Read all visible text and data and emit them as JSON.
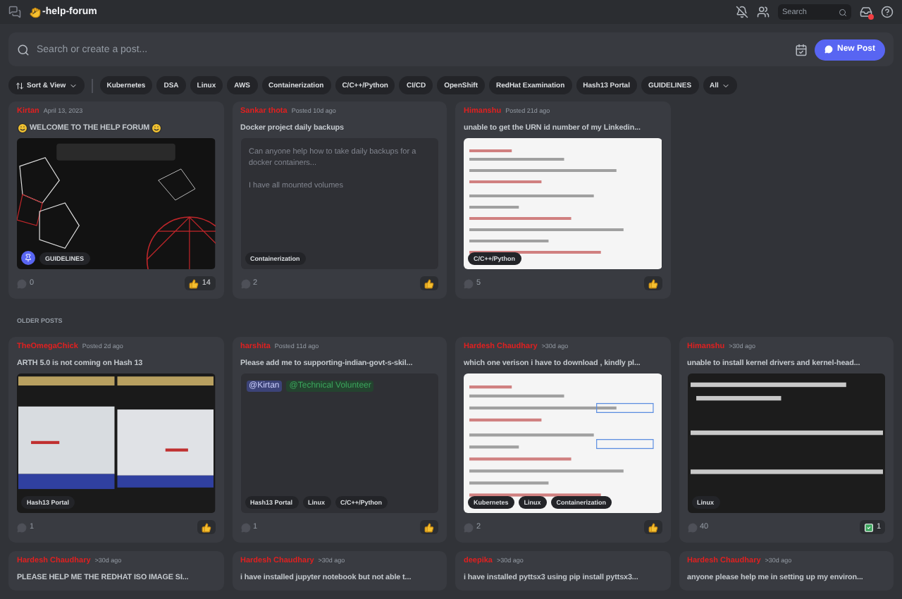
{
  "channel": {
    "name": "-help-forum",
    "search_placeholder": "Search"
  },
  "composer": {
    "placeholder": "Search or create a post...",
    "button": "New Post"
  },
  "filters": {
    "sort": "Sort & View",
    "tags": [
      {
        "label": "Kubernetes",
        "selected": false
      },
      {
        "label": "DSA",
        "selected": false
      },
      {
        "label": "Linux",
        "selected": false
      },
      {
        "label": "AWS",
        "selected": false
      },
      {
        "label": "Containerization",
        "selected": false
      },
      {
        "label": "C/C++/Python",
        "selected": false
      },
      {
        "label": "CI/CD",
        "selected": false
      },
      {
        "label": "OpenShift",
        "selected": false
      },
      {
        "label": "RedHat Examination",
        "selected": false
      },
      {
        "label": "Hash13 Portal",
        "selected": false
      },
      {
        "label": "GUIDELINES",
        "selected": false
      }
    ],
    "all": "All"
  },
  "pinned_posts": [
    {
      "author": "Kirtan",
      "time": "April 13, 2023",
      "title": "WELCOME TO THE HELP FORUM",
      "title_emoji": true,
      "media": {
        "kind": "picture"
      },
      "pinned": true,
      "tags": [
        "GUIDELINES"
      ],
      "comments": "0",
      "reaction": {
        "kind": "thumbs-up",
        "count": "14"
      }
    },
    {
      "author": "Sankar thota",
      "time": "Posted 10d ago",
      "title": "Docker project daily backups",
      "media": {
        "kind": "text",
        "paragraphs": [
          "Can anyone help how to take daily backups for a docker containers...",
          "I have all mounted volumes"
        ]
      },
      "tags": [
        "Containerization"
      ],
      "comments": "2",
      "reaction": {
        "kind": "thumbs-up"
      }
    },
    {
      "author": "Himanshu",
      "time": "Posted 21d ago",
      "title": "unable to get the URN id number of my Linkedin...",
      "media": {
        "kind": "picture"
      },
      "tags": [
        "C/C++/Python"
      ],
      "comments": "5",
      "reaction": {
        "kind": "thumbs-up"
      }
    }
  ],
  "section_label": "OLDER POSTS",
  "older_posts": [
    {
      "author": "TheOmegaChick",
      "time": "Posted 2d ago",
      "title": "ARTH 5.0 is not coming on Hash 13",
      "media": {
        "kind": "picture-pair"
      },
      "tags": [
        "Hash13 Portal"
      ],
      "comments": "1",
      "reaction": {
        "kind": "thumbs-up"
      }
    },
    {
      "author": "harshita",
      "time": "Posted 11d ago",
      "title": "Please add me to supporting-indian-govt-s-skil...",
      "media": {
        "kind": "mentions",
        "mentions": [
          {
            "text": "@Kirtan",
            "color": "#3c4378"
          },
          {
            "text": "@Technical Volunteer",
            "color": "#24432f"
          }
        ]
      },
      "tags": [
        "Hash13 Portal",
        "Linux",
        "C/C++/Python"
      ],
      "comments": "1",
      "reaction": {
        "kind": "thumbs-up"
      }
    },
    {
      "author": "Hardesh Chaudhary",
      "time": ">30d ago",
      "title": "which one verison i have to download , kindly pl...",
      "media": {
        "kind": "picture"
      },
      "tags": [
        "Kubernetes",
        "Linux",
        "Containerization"
      ],
      "comments": "2",
      "reaction": {
        "kind": "thumbs-up"
      }
    },
    {
      "author": "Himanshu",
      "time": ">30d ago",
      "title": "unable to install kernel drivers and kernel-head...",
      "media": {
        "kind": "picture"
      },
      "tags": [
        "Linux"
      ],
      "comments": "40",
      "reaction": {
        "kind": "check",
        "count": "1"
      }
    },
    {
      "author": "Hardesh Chaudhary",
      "time": ">30d ago",
      "title": "PLEASE HELP ME THE REDHAT ISO IMAGE SI..."
    },
    {
      "author": "Hardesh Chaudhary",
      "time": ">30d ago",
      "title": "i have installed jupyter notebook but not able t..."
    },
    {
      "author": "deepika",
      "time": ">30d ago",
      "title": "i have installed pyttsx3 using pip install pyttsx3..."
    },
    {
      "author": "Hardesh Chaudhary",
      "time": ">30d ago",
      "title": "anyone please help me in setting up my environ..."
    }
  ]
}
